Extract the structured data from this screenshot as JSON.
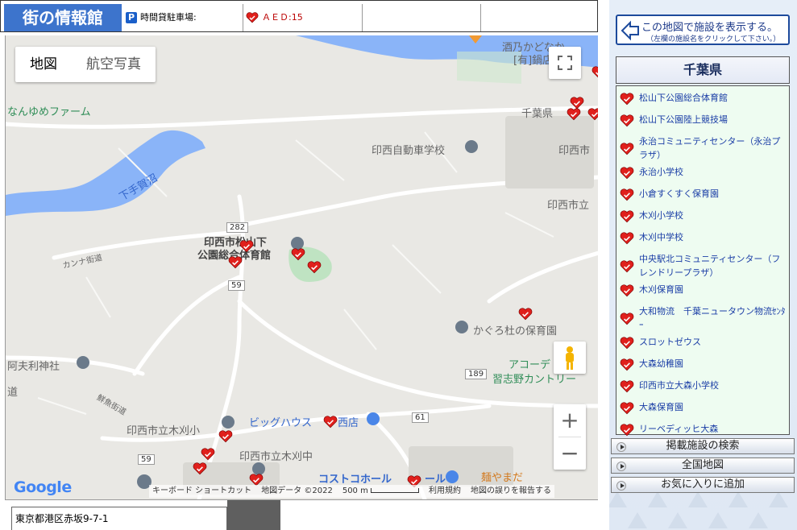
{
  "header": {
    "logo": "街の情報館",
    "parking_icon": "P",
    "parking_label": "時間貸駐車場:",
    "aed_label": "ＡＥＤ:15"
  },
  "map": {
    "maptype": {
      "map": "地図",
      "satellite": "航空写真"
    },
    "places": [
      {
        "text": "酒乃かどなか",
        "cls": ""
      },
      {
        "text": "[有]鍋店",
        "cls": ""
      },
      {
        "text": "なんゆめファーム",
        "cls": "green"
      },
      {
        "text": "千葉県",
        "cls": ""
      },
      {
        "text": "印西自動車学校",
        "cls": ""
      },
      {
        "text": "印西市",
        "cls": ""
      },
      {
        "text": "下手賀沼",
        "cls": "blue"
      },
      {
        "text": "印西市立",
        "cls": ""
      },
      {
        "text": "印西市松山下",
        "cls": "dark"
      },
      {
        "text": "公園総合体育館",
        "cls": "dark"
      },
      {
        "text": "カンナ街道",
        "cls": ""
      },
      {
        "text": "かぐろ杜の保育園",
        "cls": ""
      },
      {
        "text": "阿夫利神社",
        "cls": ""
      },
      {
        "text": "アコーデ",
        "cls": "green"
      },
      {
        "text": "習志野カントリー",
        "cls": "green"
      },
      {
        "text": "ビッグハウス",
        "cls": "blue"
      },
      {
        "text": "西店",
        "cls": "blue"
      },
      {
        "text": "印西市立木刈小",
        "cls": ""
      },
      {
        "text": "印西市立木刈中",
        "cls": ""
      },
      {
        "text": "コストコホール",
        "cls": "blue"
      },
      {
        "text": "ール",
        "cls": "blue"
      },
      {
        "text": "麺やまだ",
        "cls": "orange"
      },
      {
        "text": "道",
        "cls": ""
      },
      {
        "text": "鮮魚街道",
        "cls": ""
      }
    ],
    "road_badges": [
      "282",
      "59",
      "189",
      "61",
      "59"
    ],
    "google_logo": "Google",
    "attribution": {
      "shortcuts": "キーボード ショートカット",
      "mapdata": "地図データ ©2022",
      "scale": "500 m",
      "terms": "利用規約",
      "report": "地図の誤りを報告する"
    }
  },
  "address": "東京都港区赤坂9-7-1",
  "panel": {
    "show_button": {
      "line1": "この地図で施設を表示する。",
      "line2": "（左欄の施設名をクリックして下さい。）"
    },
    "prefecture": "千葉県",
    "facilities": [
      "松山下公園総合体育館",
      "松山下公園陸上競技場",
      "永治コミュニティセンター（永治プラザ）",
      "永治小学校",
      "小倉すくすく保育園",
      "木刈小学校",
      "木刈中学校",
      "中央駅北コミュニティセンター（フレンドリープラザ）",
      "木刈保育園",
      "大和物流　千葉ニュータウン物流ｾﾝﾀｰ",
      "スロットゼウス",
      "大森幼稚園",
      "印西市立大森小学校",
      "大森保育園",
      "リーベディッヒ大森"
    ],
    "menu": [
      "掲載施設の検索",
      "全国地図",
      "お気に入りに追加"
    ]
  },
  "colors": {
    "logo_bg": "#3d74cc",
    "aed_heart": "#e0201c",
    "link": "#1b3ea6"
  }
}
